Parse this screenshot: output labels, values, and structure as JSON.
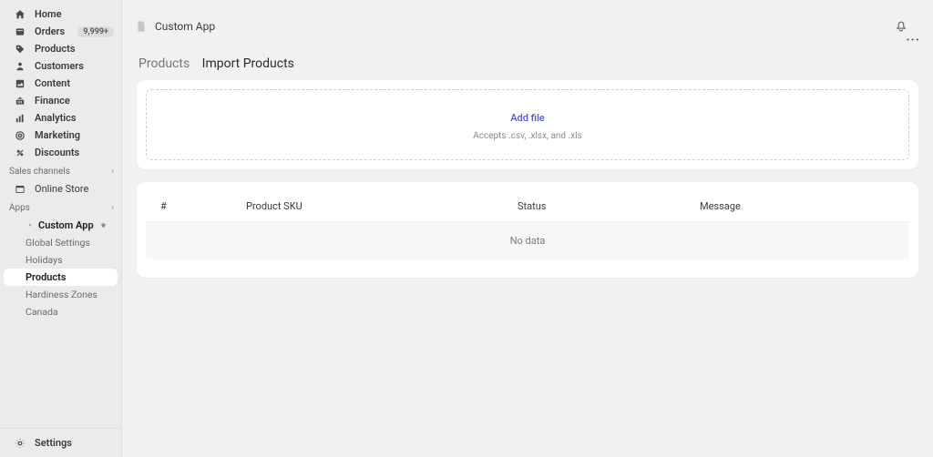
{
  "sidebar": {
    "nav": [
      {
        "label": "Home"
      },
      {
        "label": "Orders",
        "badge": "9,999+"
      },
      {
        "label": "Products"
      },
      {
        "label": "Customers"
      },
      {
        "label": "Content"
      },
      {
        "label": "Finance"
      },
      {
        "label": "Analytics"
      },
      {
        "label": "Marketing"
      },
      {
        "label": "Discounts"
      }
    ],
    "sales_channels_label": "Sales channels",
    "online_store_label": "Online Store",
    "apps_label": "Apps",
    "custom_app_label": "Custom App",
    "app_sub": [
      "Global Settings",
      "Holidays",
      "Products",
      "Hardiness Zones",
      "Canada"
    ],
    "settings_label": "Settings"
  },
  "topbar": {
    "title": "Custom App"
  },
  "breadcrumb": {
    "link": "Products",
    "current": "Import Products"
  },
  "upload": {
    "add_file": "Add file",
    "accepts": "Accepts .csv, .xlsx, and .xls"
  },
  "table": {
    "col_num": "#",
    "col_sku": "Product SKU",
    "col_status": "Status",
    "col_message": "Message",
    "empty": "No data"
  }
}
